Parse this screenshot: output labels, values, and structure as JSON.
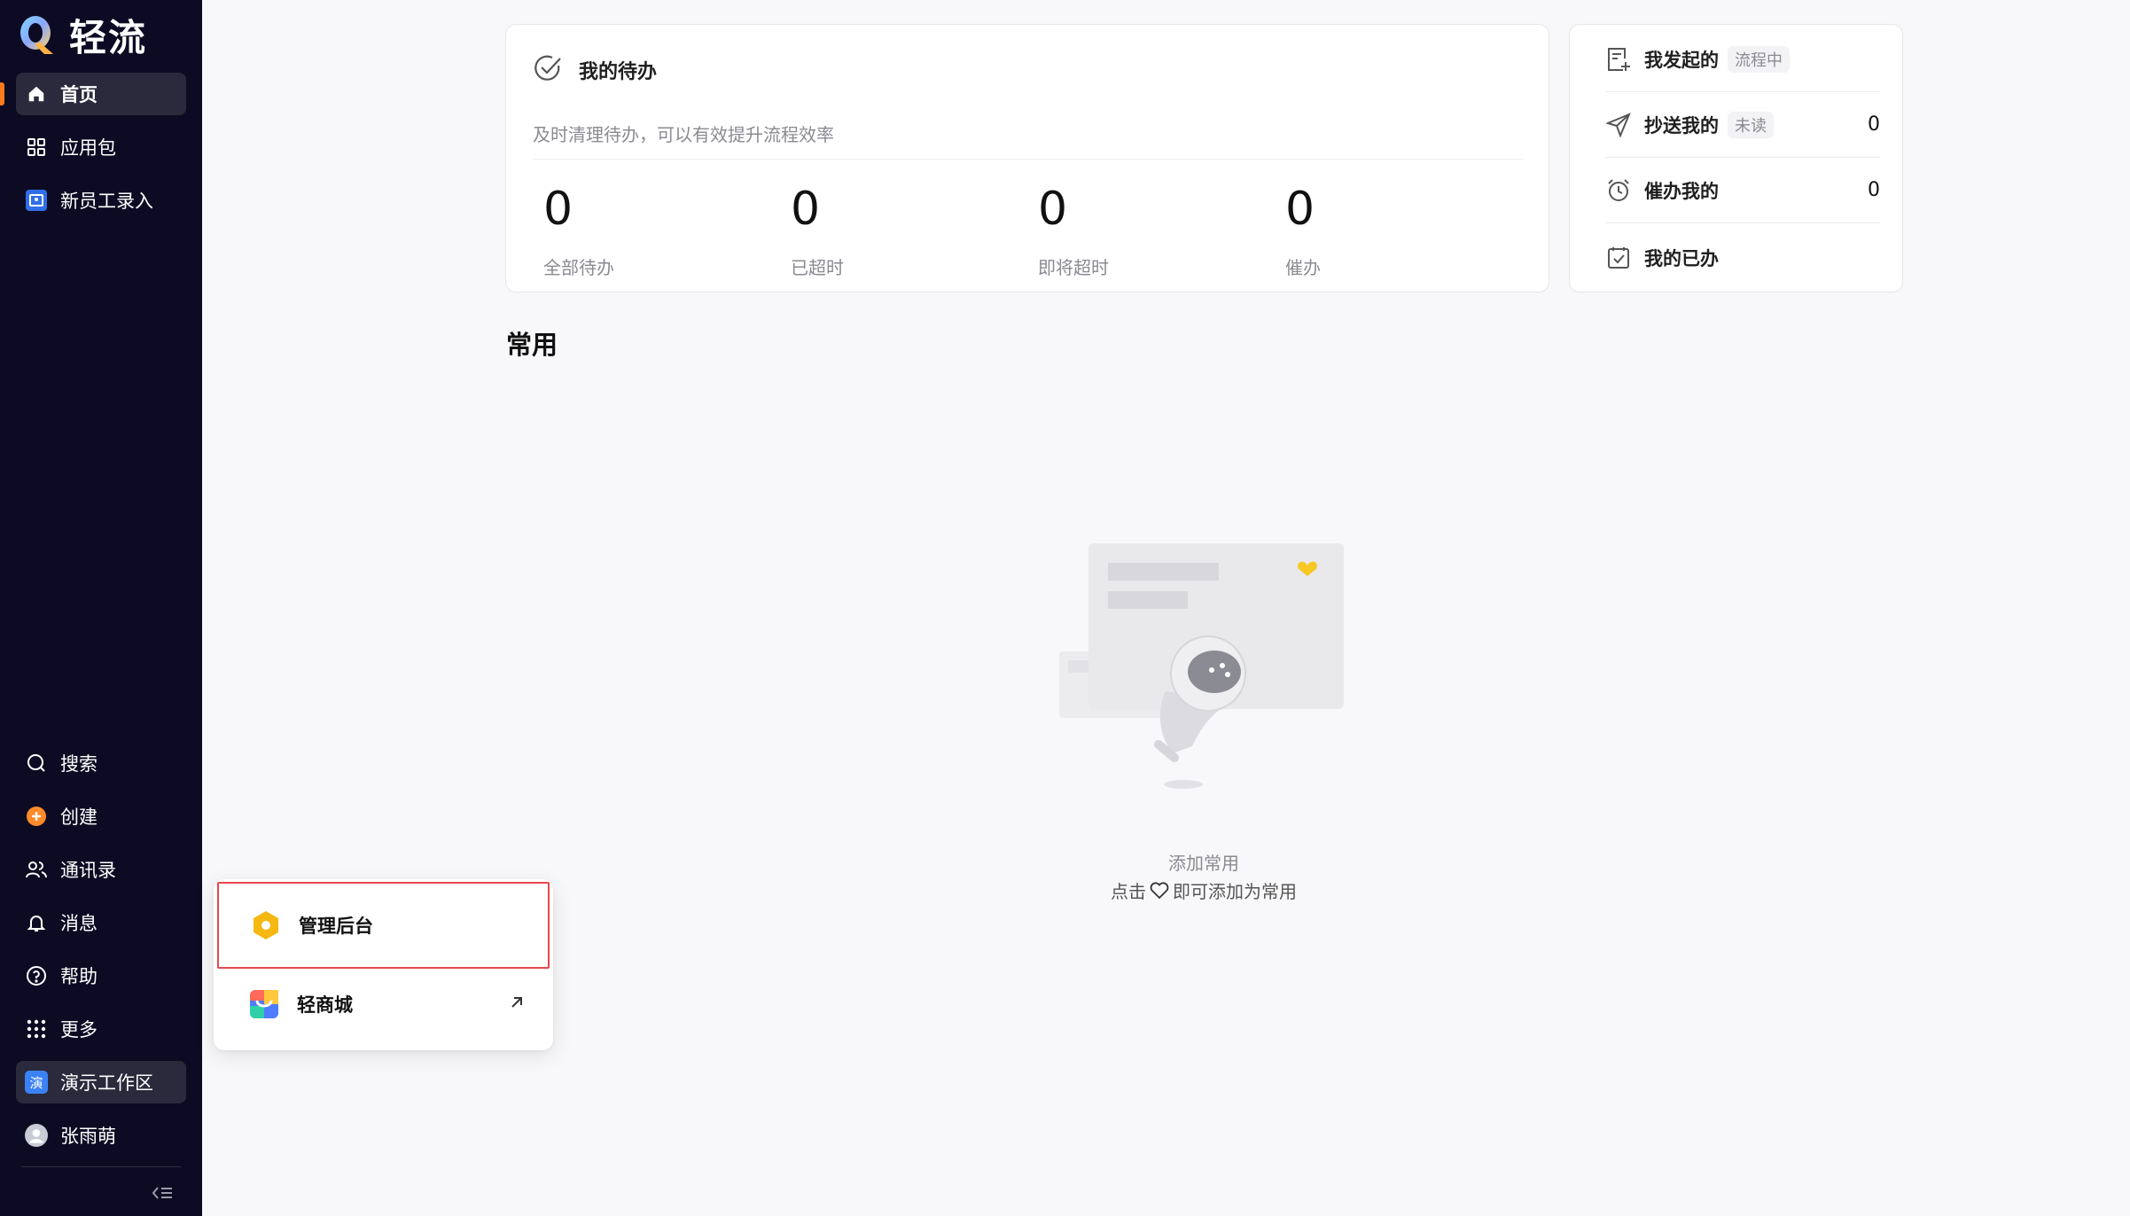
{
  "app": {
    "logo_text": "轻流"
  },
  "sidebar": {
    "top_items": [
      {
        "label": "首页",
        "icon": "home-icon"
      },
      {
        "label": "应用包",
        "icon": "grid-icon"
      },
      {
        "label": "新员工录入",
        "icon": "app-tile-icon"
      }
    ],
    "bottom_items": [
      {
        "label": "搜索",
        "icon": "search-icon"
      },
      {
        "label": "创建",
        "icon": "plus-circle-icon"
      },
      {
        "label": "通讯录",
        "icon": "contacts-icon"
      },
      {
        "label": "消息",
        "icon": "bell-icon"
      },
      {
        "label": "帮助",
        "icon": "help-icon"
      },
      {
        "label": "更多",
        "icon": "dots-grid-icon"
      }
    ],
    "workspace": {
      "label": "演示工作区",
      "badge": "演"
    },
    "user": {
      "name": "张雨萌"
    }
  },
  "todo": {
    "title": "我的待办",
    "subtitle": "及时清理待办，可以有效提升流程效率",
    "stats": [
      {
        "value": "0",
        "label": "全部待办"
      },
      {
        "value": "0",
        "label": "已超时"
      },
      {
        "value": "0",
        "label": "即将超时"
      },
      {
        "value": "0",
        "label": "催办"
      }
    ]
  },
  "side_panel": {
    "rows": [
      {
        "label": "我发起的",
        "tag": "流程中",
        "count": ""
      },
      {
        "label": "抄送我的",
        "tag": "未读",
        "count": "0"
      },
      {
        "label": "催办我的",
        "tag": "",
        "count": "0"
      },
      {
        "label": "我的已办",
        "tag": "",
        "count": ""
      }
    ]
  },
  "common": {
    "title": "常用",
    "empty_title": "添加常用",
    "empty_hint_pre": "点击",
    "empty_hint_post": "即可添加为常用"
  },
  "popup": {
    "items": [
      {
        "label": "管理后台",
        "icon": "hexagon-icon"
      },
      {
        "label": "轻商城",
        "icon": "store-icon"
      }
    ]
  },
  "colors": {
    "sidebar_bg": "#0d0b23",
    "active_accent": "#ff7a1a",
    "highlight_border": "#e5484d",
    "admin_icon": "#f5b812"
  }
}
